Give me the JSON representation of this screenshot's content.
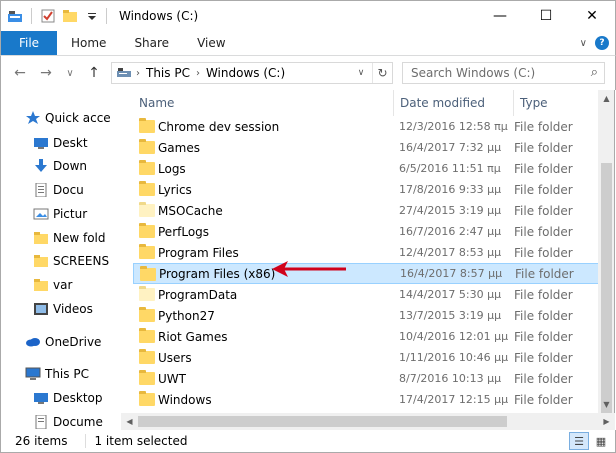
{
  "window": {
    "title": "Windows (C:)",
    "minimize_glyph": "—",
    "maximize_glyph": "☐",
    "close_glyph": "✕"
  },
  "ribbon": {
    "tabs": [
      "File",
      "Home",
      "Share",
      "View"
    ],
    "expand_glyph": "∨",
    "help_glyph": "?"
  },
  "nav": {
    "back_glyph": "←",
    "forward_glyph": "→",
    "recent_glyph": "∨",
    "up_glyph": "↑"
  },
  "address": {
    "crumbs": [
      "This PC",
      "Windows (C:)"
    ],
    "separator": "›",
    "dropdown_glyph": "∨",
    "refresh_glyph": "↻"
  },
  "search": {
    "placeholder": "Search Windows (C:)",
    "icon": "search-icon",
    "glyph": "⌕"
  },
  "sidebar": {
    "items": [
      {
        "label": "Quick acce",
        "icon": "star-icon",
        "pinned": false,
        "expand": ""
      },
      {
        "label": "Deskt",
        "icon": "desktop-icon",
        "pinned": true
      },
      {
        "label": "Down",
        "icon": "download-icon",
        "pinned": true
      },
      {
        "label": "Docu",
        "icon": "document-icon",
        "pinned": true
      },
      {
        "label": "Pictur",
        "icon": "picture-icon",
        "pinned": true
      },
      {
        "label": "New fold",
        "icon": "folder-icon",
        "pinned": false
      },
      {
        "label": "SCREENS",
        "icon": "folder-icon",
        "pinned": false
      },
      {
        "label": "var",
        "icon": "folder-icon",
        "pinned": false
      },
      {
        "label": "Videos",
        "icon": "video-icon",
        "pinned": false
      },
      {
        "label": "OneDrive",
        "icon": "cloud-icon",
        "pinned": false
      },
      {
        "label": "This PC",
        "icon": "computer-icon",
        "pinned": false
      },
      {
        "label": "Desktop",
        "icon": "desktop-icon",
        "pinned": false
      },
      {
        "label": "Docume",
        "icon": "document-icon",
        "pinned": false
      }
    ],
    "pin_glyph": "⫫"
  },
  "columns": {
    "name": "Name",
    "date": "Date modified",
    "type": "Type",
    "sort_glyph": "˄"
  },
  "files": [
    {
      "name": "Chrome dev session",
      "date": "12/3/2016 12:58 πμ",
      "type": "File folder",
      "selected": false,
      "light": false
    },
    {
      "name": "Games",
      "date": "16/4/2017 7:32 μμ",
      "type": "File folder",
      "selected": false,
      "light": false
    },
    {
      "name": "Logs",
      "date": "6/5/2016 11:51 πμ",
      "type": "File folder",
      "selected": false,
      "light": false
    },
    {
      "name": "Lyrics",
      "date": "17/8/2016 9:33 μμ",
      "type": "File folder",
      "selected": false,
      "light": false
    },
    {
      "name": "MSOCache",
      "date": "27/4/2015 3:19 μμ",
      "type": "File folder",
      "selected": false,
      "light": true
    },
    {
      "name": "PerfLogs",
      "date": "16/7/2016 2:47 μμ",
      "type": "File folder",
      "selected": false,
      "light": false
    },
    {
      "name": "Program Files",
      "date": "12/4/2017 8:53 μμ",
      "type": "File folder",
      "selected": false,
      "light": false
    },
    {
      "name": "Program Files (x86)",
      "date": "16/4/2017 8:57 μμ",
      "type": "File folder",
      "selected": true,
      "light": false
    },
    {
      "name": "ProgramData",
      "date": "14/4/2017 5:30 μμ",
      "type": "File folder",
      "selected": false,
      "light": true
    },
    {
      "name": "Python27",
      "date": "13/7/2015 3:19 μμ",
      "type": "File folder",
      "selected": false,
      "light": false
    },
    {
      "name": "Riot Games",
      "date": "10/4/2016 12:01 μμ",
      "type": "File folder",
      "selected": false,
      "light": false
    },
    {
      "name": "Users",
      "date": "1/11/2016 10:46 μμ",
      "type": "File folder",
      "selected": false,
      "light": false
    },
    {
      "name": "UWT",
      "date": "8/7/2016 10:13 μμ",
      "type": "File folder",
      "selected": false,
      "light": false
    },
    {
      "name": "Windows",
      "date": "17/4/2017 12:15 μμ",
      "type": "File folder",
      "selected": false,
      "light": false
    }
  ],
  "status": {
    "count": "26 items",
    "selection": "1 item selected",
    "details_view_glyph": "☰",
    "icons_view_glyph": "▦"
  },
  "colors": {
    "accent": "#1979ca",
    "selection": "#cce8ff",
    "annotation_arrow": "#d0021b"
  }
}
